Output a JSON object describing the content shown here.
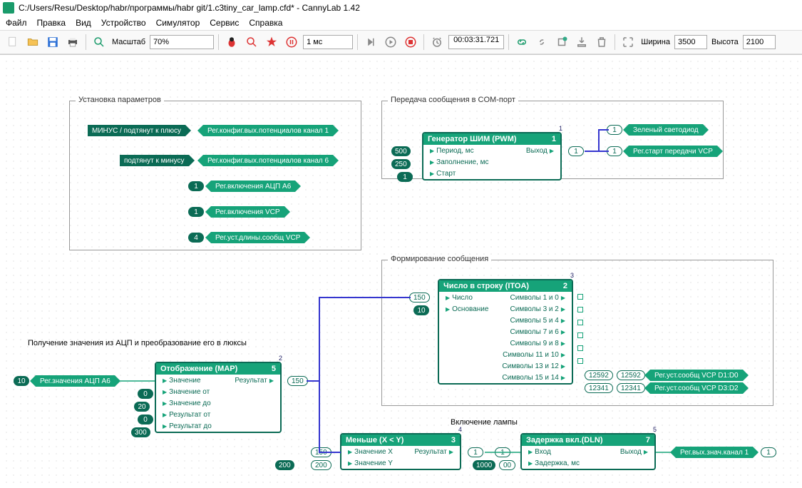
{
  "window": {
    "title": "C:/Users/Resu/Desktop/habr/программы/habr git/1.c3tiny_car_lamp.cfd* - CannyLab 1.42"
  },
  "menu": [
    "Файл",
    "Правка",
    "Вид",
    "Устройство",
    "Симулятор",
    "Сервис",
    "Справка"
  ],
  "toolbar": {
    "zoom_label": "Масштаб",
    "zoom_value": "70%",
    "step_value": "1 мс",
    "time_value": "00:03:31.721",
    "width_label": "Ширина",
    "width_value": "3500",
    "height_label": "Высота",
    "height_value": "2100"
  },
  "groups": {
    "g1": {
      "title": "Установка параметров"
    },
    "g2": {
      "title": "Передача сообщения в COM-порт"
    },
    "g3": {
      "title": "Формирование сообщения"
    },
    "g4": {
      "title": "Получение значения из АЦП и преобразование его в люксы"
    },
    "g5": {
      "title": "Включение лампы"
    }
  },
  "chips": {
    "minus_pull": "МИНУС / подтянут к плюсу",
    "reg_pot1": "Рег.конфиг.вых.потенциалов канал 1",
    "pull_minus": "подтянут к минусу",
    "reg_pot6": "Рег.конфиг.вых.потенциалов канал 6",
    "reg_adc": "Рег.включения АЦП A6",
    "reg_vcp_en": "Рег.включения VCP",
    "reg_vcp_len": "Рег.уст.длины.сообщ VCP",
    "green_led": "Зеленый светодиод",
    "reg_vcp_start": "Рег.старт передачи VCP",
    "reg_adc_val": "Рег.значения АЦП A6",
    "reg_vcp_d10": "Рег.уст.сообщ VCP D1:D0",
    "reg_vcp_d32": "Рег.уст.сообщ VCP D3:D2",
    "reg_out1": "Рег.вых.знач.канал 1"
  },
  "vals": {
    "one_a": "1",
    "one_b": "1",
    "four": "4",
    "p500": "500",
    "p250": "250",
    "p1": "1",
    "pwm_out1": "1",
    "pwm_out_num": "1",
    "adc_in": "10",
    "map_v0": "0",
    "map_v20": "20",
    "map_v0b": "0",
    "map_v300": "300",
    "map_out": "150",
    "map_extra": "150",
    "comp_in": "200",
    "comp_200": "200",
    "comp_out": "1",
    "comp_res": "1",
    "dln_in": "1000",
    "dln_00": "00",
    "dln_out": "1",
    "itoa_in": "150",
    "itoa_base": "10",
    "sym_12592a": "12592",
    "sym_12592b": "12592",
    "sym_12341a": "12341",
    "sym_12341b": "12341"
  },
  "blocks": {
    "pwm": {
      "title": "Генератор ШИМ (PWM)",
      "idx": "1",
      "tag": "1",
      "in": [
        "Период, мс",
        "Заполнение, мс",
        "Старт"
      ],
      "out": [
        "Выход"
      ]
    },
    "itoa": {
      "title": "Число в строку (ITOA)",
      "idx": "2",
      "tag": "3",
      "in": [
        "Число",
        "Основание"
      ],
      "out": [
        "Символы 1 и 0",
        "Символы 3 и 2",
        "Символы 5 и 4",
        "Символы 7 и 6",
        "Символы 9 и 8",
        "Символы 11 и 10",
        "Символы 13 и 12",
        "Символы 15 и 14"
      ]
    },
    "map": {
      "title": "Отображение (MAP)",
      "idx": "5",
      "tag": "2",
      "in": [
        "Значение",
        "Значение от",
        "Значение до",
        "Результат от",
        "Результат до"
      ],
      "out": [
        "Результат"
      ]
    },
    "lt": {
      "title": "Меньше (X < Y)",
      "idx": "3",
      "tag": "4",
      "in": [
        "Значение X",
        "Значение Y"
      ],
      "out": [
        "Результат"
      ]
    },
    "dln": {
      "title": "Задержка вкл.(DLN)",
      "idx": "7",
      "tag": "5",
      "in": [
        "Вход",
        "Задержка, мс"
      ],
      "out": [
        "Выход"
      ]
    }
  }
}
